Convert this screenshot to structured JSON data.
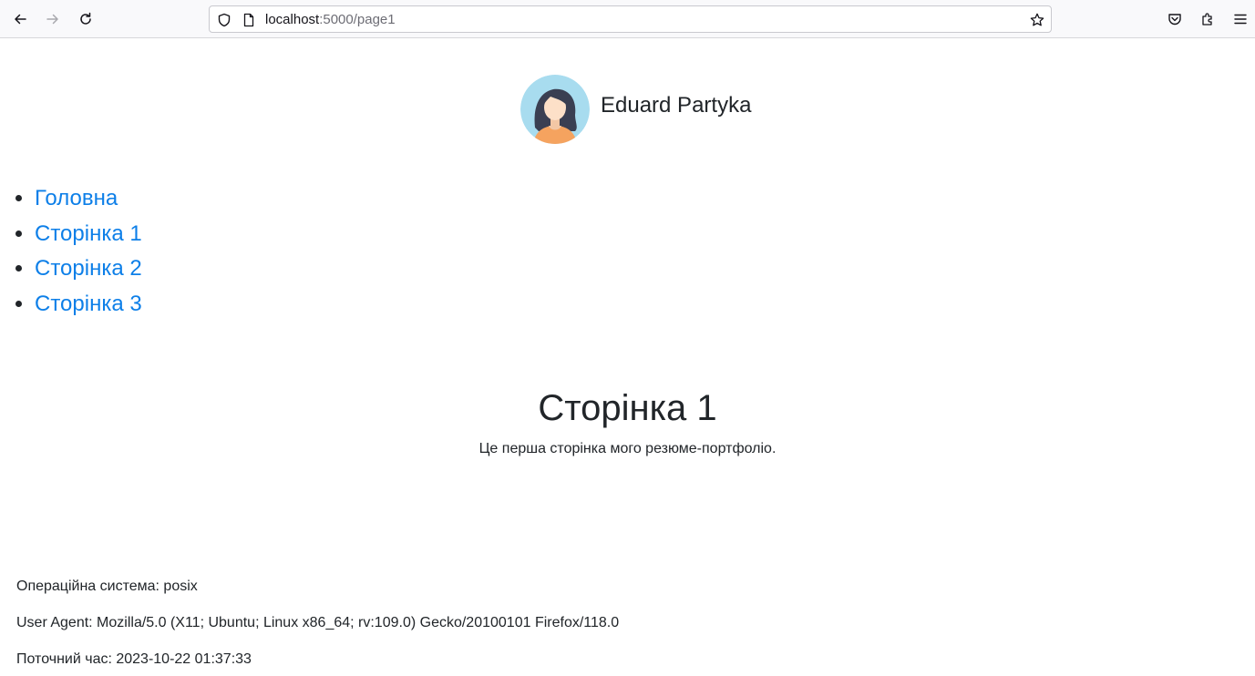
{
  "browser": {
    "url_host": "localhost",
    "url_path": ":5000/page1",
    "icons": {
      "back": "arrow-left-icon",
      "forward": "arrow-right-icon",
      "reload": "reload-icon",
      "shield": "shield-icon",
      "page": "page-icon",
      "bookmark": "star-icon",
      "pocket": "pocket-icon",
      "extensions": "puzzle-icon",
      "menu": "hamburger-menu-icon"
    }
  },
  "header": {
    "name": "Eduard Partyka",
    "avatar_icon": "avatar-woman-icon"
  },
  "nav": {
    "items": [
      {
        "label": "Головна"
      },
      {
        "label": "Сторінка 1"
      },
      {
        "label": "Сторінка 2"
      },
      {
        "label": "Сторінка 3"
      }
    ]
  },
  "main": {
    "title": "Сторінка 1",
    "text": "Це перша сторінка мого резюме-портфоліо."
  },
  "info": {
    "os": "Операційна система: posix",
    "user_agent": "User Agent: Mozilla/5.0 (X11; Ubuntu; Linux x86_64; rv:109.0) Gecko/20100101 Firefox/118.0",
    "time": "Поточний час: 2023-10-22 01:37:33"
  },
  "colors": {
    "link": "#0d7fe8",
    "text": "#212529",
    "avatar_bg": "#a8dcef",
    "toolbar_bg": "#f9f9fb"
  }
}
